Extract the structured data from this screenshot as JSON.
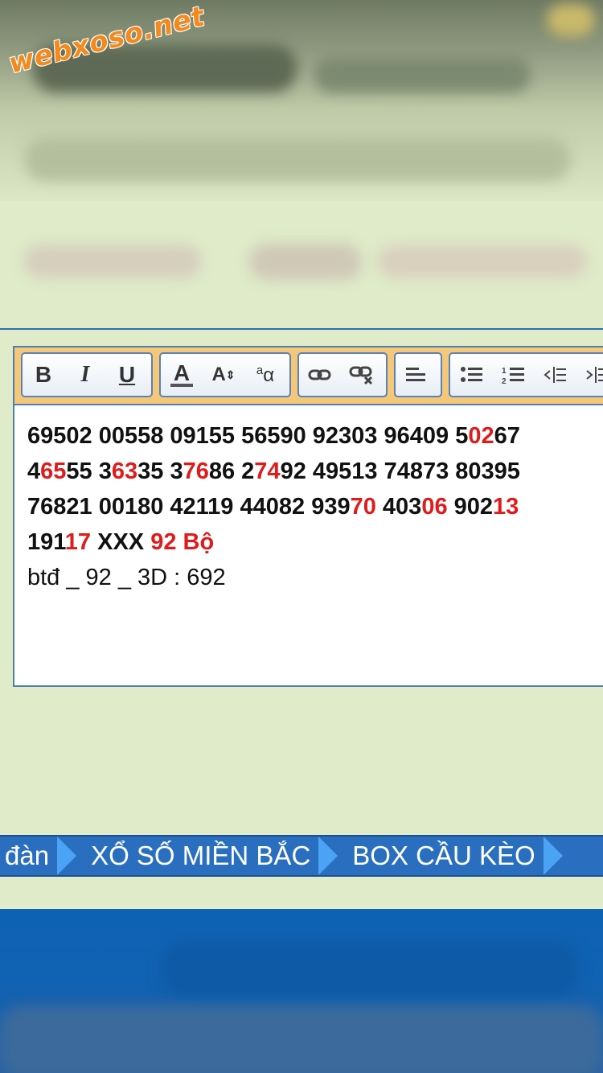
{
  "watermark": "webxoso.net",
  "toolbar": {
    "bold": "B",
    "italic": "I",
    "underline": "U",
    "font_color": "A",
    "font_size": "A",
    "superscript": "a"
  },
  "editor": {
    "lines": [
      [
        {
          "t": "69502 00558 09155 56590 92303 96409 5"
        },
        {
          "t": "02",
          "red": true
        },
        {
          "t": "67"
        }
      ],
      [
        {
          "t": "4"
        },
        {
          "t": "65",
          "red": true
        },
        {
          "t": "55 3"
        },
        {
          "t": "63",
          "red": true
        },
        {
          "t": "35 3"
        },
        {
          "t": "76",
          "red": true
        },
        {
          "t": "86 2"
        },
        {
          "t": "74",
          "red": true
        },
        {
          "t": "92 49513 74873 80395"
        }
      ],
      [
        {
          "t": "76821 00180 42119 44082 939"
        },
        {
          "t": "70",
          "red": true
        },
        {
          "t": " 403"
        },
        {
          "t": "06",
          "red": true
        },
        {
          "t": " 902"
        },
        {
          "t": "13",
          "red": true
        }
      ],
      [
        {
          "t": "191"
        },
        {
          "t": "17",
          "red": true
        },
        {
          "t": " XXX "
        },
        {
          "t": "92 Bộ",
          "red": true
        }
      ]
    ],
    "plain_line": "btđ _ 92 _ 3D : 692"
  },
  "nav": {
    "items": [
      "đàn",
      "XỔ SỐ MIỀN BẮC",
      "BOX CẦU KÈO"
    ]
  },
  "colors": {
    "accent_red": "#e01b1b",
    "nav_blue": "#2a6fbf",
    "toolbar_bg": "#f4c779",
    "page_bg": "#dfebc9"
  }
}
